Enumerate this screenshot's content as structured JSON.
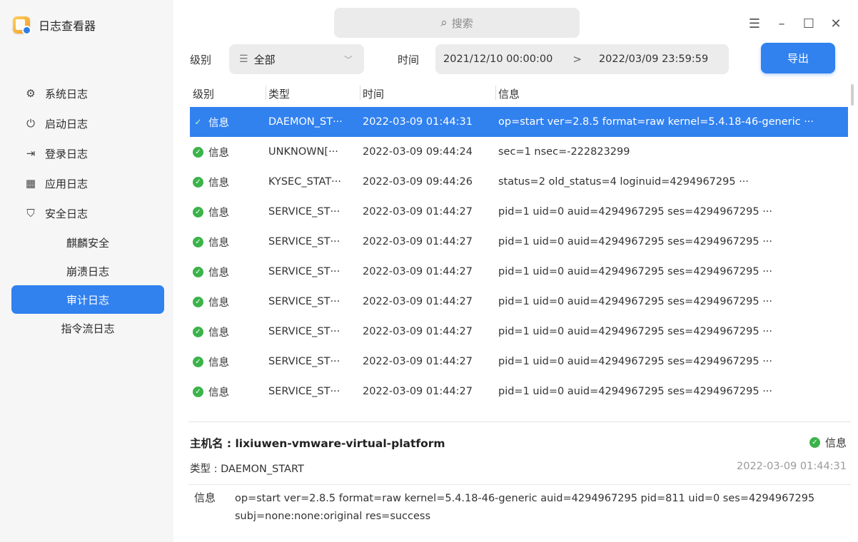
{
  "app": {
    "title": "日志查看器",
    "icon": "log-viewer-app-icon"
  },
  "search": {
    "placeholder": "搜索"
  },
  "window": {
    "menu": "☰",
    "minimize": "–",
    "maximize": "☐",
    "close": "✕"
  },
  "sidebar": {
    "items": [
      {
        "label": "系统日志",
        "icon": "⚙"
      },
      {
        "label": "启动日志",
        "icon": "⏻"
      },
      {
        "label": "登录日志",
        "icon": "⇥"
      },
      {
        "label": "应用日志",
        "icon": "▦"
      },
      {
        "label": "安全日志",
        "icon": "⛉"
      }
    ],
    "sub_items": [
      {
        "label": "麒麟安全",
        "active": false
      },
      {
        "label": "崩溃日志",
        "active": false
      },
      {
        "label": "审计日志",
        "active": true
      },
      {
        "label": "指令流日志",
        "active": false
      }
    ]
  },
  "filter": {
    "level_label": "级别",
    "level_value": "全部",
    "time_label": "时间",
    "start_time": "2021/12/10 00:00:00",
    "end_time": "2022/03/09 23:59:59",
    "range_arrow": ">",
    "export_label": "导出"
  },
  "table": {
    "headers": [
      "级别",
      "类型",
      "时间",
      "信息"
    ],
    "rows": [
      {
        "level": "信息",
        "type": "DAEMON_ST···",
        "time": "2022-03-09 01:44:31",
        "info": "op=start ver=2.8.5 format=raw kernel=5.4.18-46-generic ···",
        "selected": true
      },
      {
        "level": "信息",
        "type": "UNKNOWN[···",
        "time": "2022-03-09 09:44:24",
        "info": "sec=1 nsec=-222823299",
        "selected": false
      },
      {
        "level": "信息",
        "type": "KYSEC_STAT···",
        "time": "2022-03-09 09:44:26",
        "info": "status=2 old_status=4  loginuid=4294967295 ···",
        "selected": false
      },
      {
        "level": "信息",
        "type": "SERVICE_ST···",
        "time": "2022-03-09 01:44:27",
        "info": "pid=1 uid=0 auid=4294967295 ses=4294967295 ···",
        "selected": false
      },
      {
        "level": "信息",
        "type": "SERVICE_ST···",
        "time": "2022-03-09 01:44:27",
        "info": "pid=1 uid=0 auid=4294967295 ses=4294967295 ···",
        "selected": false
      },
      {
        "level": "信息",
        "type": "SERVICE_ST···",
        "time": "2022-03-09 01:44:27",
        "info": "pid=1 uid=0 auid=4294967295 ses=4294967295 ···",
        "selected": false
      },
      {
        "level": "信息",
        "type": "SERVICE_ST···",
        "time": "2022-03-09 01:44:27",
        "info": "pid=1 uid=0 auid=4294967295 ses=4294967295 ···",
        "selected": false
      },
      {
        "level": "信息",
        "type": "SERVICE_ST···",
        "time": "2022-03-09 01:44:27",
        "info": "pid=1 uid=0 auid=4294967295 ses=4294967295 ···",
        "selected": false
      },
      {
        "level": "信息",
        "type": "SERVICE_ST···",
        "time": "2022-03-09 01:44:27",
        "info": "pid=1 uid=0 auid=4294967295 ses=4294967295 ···",
        "selected": false
      },
      {
        "level": "信息",
        "type": "SERVICE_ST···",
        "time": "2022-03-09 01:44:27",
        "info": "pid=1 uid=0 auid=4294967295 ses=4294967295 ···",
        "selected": false
      }
    ]
  },
  "detail": {
    "host": "主机名 : lixiuwen-vmware-virtual-platform",
    "level": "信息",
    "type": "类型 : DAEMON_START",
    "time": "2022-03-09 01:44:31",
    "info_label": "信息",
    "info_text": "op=start ver=2.8.5 format=raw kernel=5.4.18-46-generic auid=4294967295 pid=811 uid=0 ses=4294967295 subj=none:none:original res=success"
  },
  "colors": {
    "accent": "#3181ef",
    "success": "#3bb34a",
    "sidebar_bg": "#f6f6f6"
  }
}
